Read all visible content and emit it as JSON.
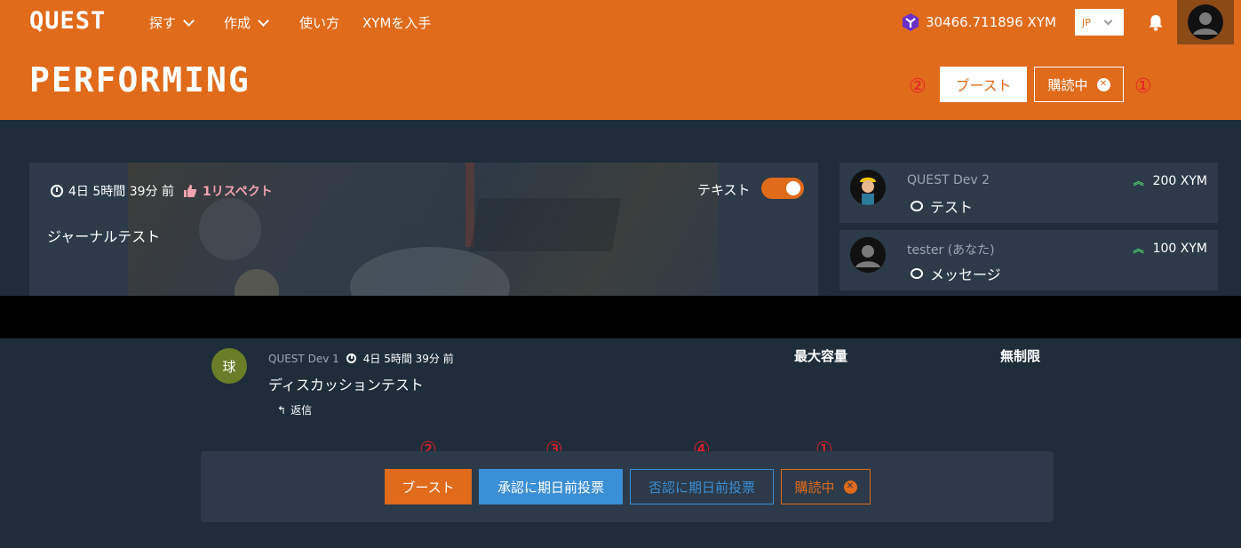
{
  "header": {
    "logo": "QUEST",
    "nav": [
      {
        "label": "探す",
        "has_dropdown": true
      },
      {
        "label": "作成",
        "has_dropdown": true
      },
      {
        "label": "使い方",
        "has_dropdown": false
      },
      {
        "label": "XYMを入手",
        "has_dropdown": false
      }
    ],
    "balance": "30466.711896 XYM",
    "language": "JP",
    "brand_color": "#e06b1b"
  },
  "page": {
    "title": "PERFORMING",
    "marker_1": "①",
    "marker_2": "②",
    "boost_label": "ブースト",
    "subscribed_label": "購読中"
  },
  "journal": {
    "time_ago": "4日 5時間 39分 前",
    "respect": "1リスペクト",
    "text": "ジャーナルテスト",
    "toggle_label": "テキスト",
    "toggle_on": true
  },
  "boosts": [
    {
      "name": "QUEST Dev 2",
      "amount": "200 XYM",
      "message": "テスト"
    },
    {
      "name": "tester (あなた)",
      "amount": "100 XYM",
      "message": "メッセージ"
    }
  ],
  "discussion": {
    "author": "QUEST Dev 1",
    "avatar_text": "球",
    "time_ago": "4日 5時間 39分 前",
    "text": "ディスカッションテスト",
    "reply_label": "返信",
    "capacity_label": "最大容量",
    "capacity_value": "無制限"
  },
  "actions": {
    "marker_1": "①",
    "marker_2": "②",
    "marker_3": "③",
    "marker_4": "④",
    "boost_label": "ブースト",
    "approve_label": "承認に期日前投票",
    "reject_label": "否認に期日前投票",
    "subscribed_label": "購読中"
  }
}
